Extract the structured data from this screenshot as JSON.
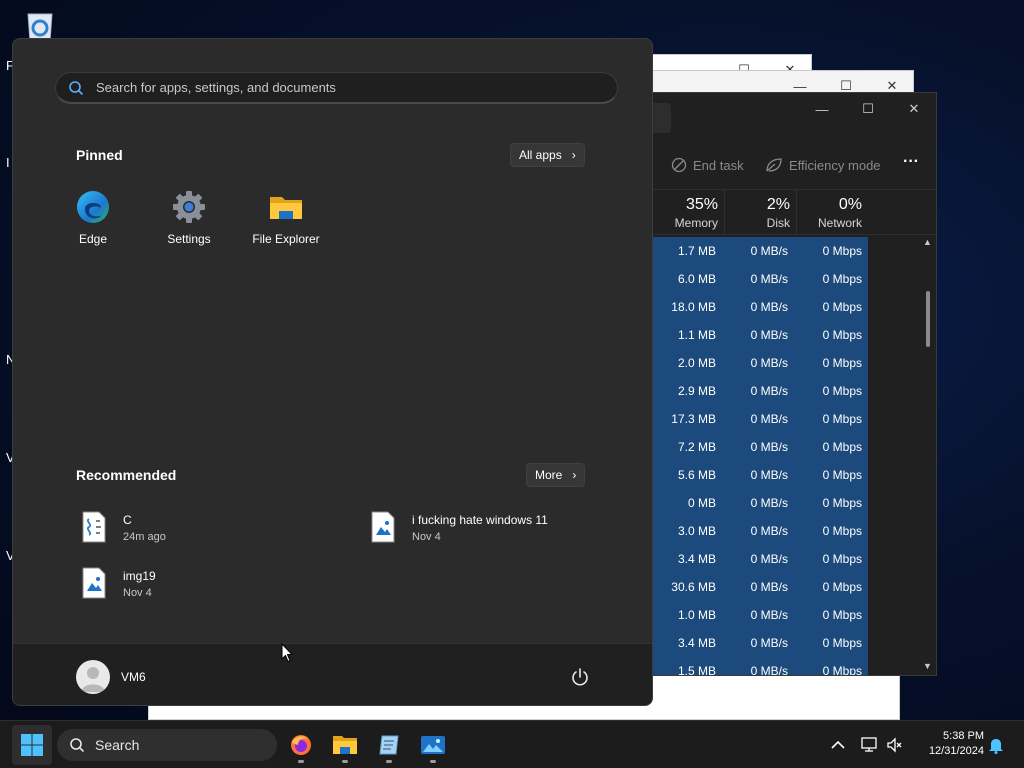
{
  "desktop": {
    "letters": [
      "F",
      "I",
      "N",
      "V",
      "V"
    ]
  },
  "task_manager": {
    "toolbar": {
      "end_task": "End task",
      "efficiency_mode": "Efficiency mode"
    },
    "columns": [
      {
        "pct": "35%",
        "label": "Memory"
      },
      {
        "pct": "2%",
        "label": "Disk"
      },
      {
        "pct": "0%",
        "label": "Network"
      }
    ],
    "rows": [
      [
        "1.7 MB",
        "0 MB/s",
        "0 Mbps"
      ],
      [
        "6.0 MB",
        "0 MB/s",
        "0 Mbps"
      ],
      [
        "18.0 MB",
        "0 MB/s",
        "0 Mbps"
      ],
      [
        "1.1 MB",
        "0 MB/s",
        "0 Mbps"
      ],
      [
        "2.0 MB",
        "0 MB/s",
        "0 Mbps"
      ],
      [
        "2.9 MB",
        "0 MB/s",
        "0 Mbps"
      ],
      [
        "17.3 MB",
        "0 MB/s",
        "0 Mbps"
      ],
      [
        "7.2 MB",
        "0 MB/s",
        "0 Mbps"
      ],
      [
        "5.6 MB",
        "0 MB/s",
        "0 Mbps"
      ],
      [
        "0 MB",
        "0 MB/s",
        "0 Mbps"
      ],
      [
        "3.0 MB",
        "0 MB/s",
        "0 Mbps"
      ],
      [
        "3.4 MB",
        "0 MB/s",
        "0 Mbps"
      ],
      [
        "30.6 MB",
        "0 MB/s",
        "0 Mbps"
      ],
      [
        "1.0 MB",
        "0 MB/s",
        "0 Mbps"
      ],
      [
        "3.4 MB",
        "0 MB/s",
        "0 Mbps"
      ],
      [
        "1.5 MB",
        "0 MB/s",
        "0 Mbps"
      ]
    ]
  },
  "start_menu": {
    "search_placeholder": "Search for apps, settings, and documents",
    "pinned": {
      "title": "Pinned",
      "all_apps": "All apps",
      "apps": [
        {
          "name": "Edge",
          "icon": "edge-icon"
        },
        {
          "name": "Settings",
          "icon": "gear-icon"
        },
        {
          "name": "File Explorer",
          "icon": "folder-icon"
        }
      ]
    },
    "recommended": {
      "title": "Recommended",
      "more": "More",
      "items": [
        {
          "name": "C",
          "time": "24m ago",
          "icon": "script-file-icon"
        },
        {
          "name": "i fucking hate windows 11",
          "time": "Nov 4",
          "icon": "image-file-icon"
        },
        {
          "name": "img19",
          "time": "Nov 4",
          "icon": "image-file-icon"
        }
      ]
    },
    "user": {
      "name": "VM6"
    }
  },
  "taskbar": {
    "search_label": "Search",
    "apps": [
      "firefox-icon",
      "file-explorer-icon",
      "notepad-icon",
      "photos-icon"
    ],
    "clock": {
      "time": "5:38 PM",
      "date": "12/31/2024"
    }
  },
  "colors": {
    "start_bg": "#2b2b2b",
    "taskbar_bg": "#1c1c1c",
    "selection_blue": "#1d4a7d",
    "accent": "#0078d4"
  }
}
